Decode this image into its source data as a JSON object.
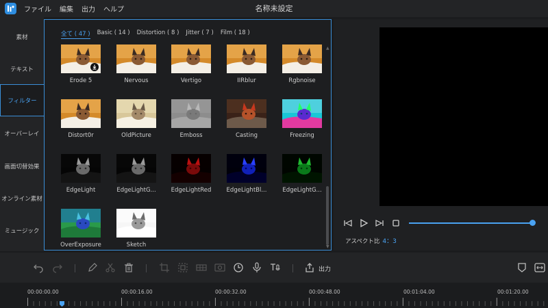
{
  "titlebar": {
    "menu": [
      "ファイル",
      "編集",
      "出力",
      "ヘルプ"
    ],
    "title": "名称未設定"
  },
  "sidebar": {
    "items": [
      {
        "label": "素材",
        "active": false
      },
      {
        "label": "テキスト",
        "active": false
      },
      {
        "label": "フィルター",
        "active": true
      },
      {
        "label": "オーバーレイ",
        "active": false
      },
      {
        "label": "画面切替効果",
        "active": false
      },
      {
        "label": "オンライン素材",
        "active": false
      },
      {
        "label": "ミュージック",
        "active": false
      }
    ]
  },
  "filter_tabs": [
    {
      "label": "全て ( 47 )",
      "active": true
    },
    {
      "label": "Basic ( 14 )",
      "active": false
    },
    {
      "label": "Distortion ( 8 )",
      "active": false
    },
    {
      "label": "Jitter ( 7 )",
      "active": false
    },
    {
      "label": "Film ( 18 )",
      "active": false
    }
  ],
  "filters": [
    {
      "name": "Erode 5",
      "style": "orig",
      "download": true
    },
    {
      "name": "Nervous",
      "style": "orig"
    },
    {
      "name": "Vertigo",
      "style": "orig"
    },
    {
      "name": "IIRblur",
      "style": "orig"
    },
    {
      "name": "Rgbnoise",
      "style": "orig"
    },
    {
      "name": "Distort0r",
      "style": "orig"
    },
    {
      "name": "OldPicture",
      "style": "old"
    },
    {
      "name": "Emboss",
      "style": "emboss"
    },
    {
      "name": "Casting",
      "style": "casting"
    },
    {
      "name": "Freezing",
      "style": "freezing"
    },
    {
      "name": "EdgeLight",
      "style": "edgewhite"
    },
    {
      "name": "EdgeLightG...",
      "style": "edgewhite"
    },
    {
      "name": "EdgeLightRed",
      "style": "edgered"
    },
    {
      "name": "EdgeLightBl...",
      "style": "edgeblue"
    },
    {
      "name": "EdgeLightG...",
      "style": "edgegreen"
    },
    {
      "name": "OverExposure",
      "style": "overexp"
    },
    {
      "name": "Sketch",
      "style": "sketch"
    }
  ],
  "preview": {
    "aspect_label": "アスペクト比",
    "aspect_value": "4：3",
    "progress": 0.97
  },
  "toolbar": {
    "export_label": "出力"
  },
  "timeline": {
    "ticks": [
      "00:00:00.00",
      "00:00:16.00",
      "00:00:32.00",
      "00:00:48.00",
      "00:01:04.00",
      "00:01:20.00"
    ]
  },
  "colors": {
    "accent": "#4aa3f3",
    "background": "#1b1c1e",
    "panel": "#232426"
  }
}
